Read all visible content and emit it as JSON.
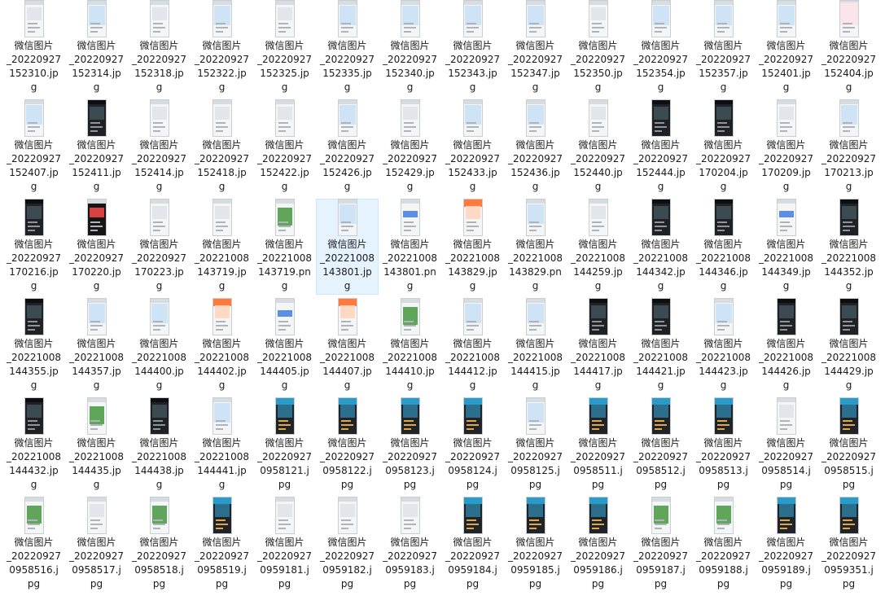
{
  "files": [
    {
      "l1": "微信图片",
      "l2": "_20220927",
      "l3": "152310.jp",
      "l4": "g",
      "thumb": "light"
    },
    {
      "l1": "微信图片",
      "l2": "_20220927",
      "l3": "152314.jp",
      "l4": "g",
      "thumb": "map"
    },
    {
      "l1": "微信图片",
      "l2": "_20220927",
      "l3": "152318.jp",
      "l4": "g",
      "thumb": "light"
    },
    {
      "l1": "微信图片",
      "l2": "_20220927",
      "l3": "152322.jp",
      "l4": "g",
      "thumb": "map"
    },
    {
      "l1": "微信图片",
      "l2": "_20220927",
      "l3": "152325.jp",
      "l4": "g",
      "thumb": "light"
    },
    {
      "l1": "微信图片",
      "l2": "_20220927",
      "l3": "152335.jp",
      "l4": "g",
      "thumb": "map"
    },
    {
      "l1": "微信图片",
      "l2": "_20220927",
      "l3": "152340.jp",
      "l4": "g",
      "thumb": "map"
    },
    {
      "l1": "微信图片",
      "l2": "_20220927",
      "l3": "152343.jp",
      "l4": "g",
      "thumb": "map"
    },
    {
      "l1": "微信图片",
      "l2": "_20220927",
      "l3": "152347.jp",
      "l4": "g",
      "thumb": "map"
    },
    {
      "l1": "微信图片",
      "l2": "_20220927",
      "l3": "152350.jp",
      "l4": "g",
      "thumb": "light"
    },
    {
      "l1": "微信图片",
      "l2": "_20220927",
      "l3": "152354.jp",
      "l4": "g",
      "thumb": "map"
    },
    {
      "l1": "微信图片",
      "l2": "_20220927",
      "l3": "152357.jp",
      "l4": "g",
      "thumb": "map"
    },
    {
      "l1": "微信图片",
      "l2": "_20220927",
      "l3": "152401.jp",
      "l4": "g",
      "thumb": "map"
    },
    {
      "l1": "微信图片",
      "l2": "_20220927",
      "l3": "152404.jp",
      "l4": "g",
      "thumb": "calli"
    },
    {
      "l1": "微信图片",
      "l2": "_20220927",
      "l3": "152407.jp",
      "l4": "g",
      "thumb": "map"
    },
    {
      "l1": "微信图片",
      "l2": "_20220927",
      "l3": "152411.jp",
      "l4": "g",
      "thumb": "dark"
    },
    {
      "l1": "微信图片",
      "l2": "_20220927",
      "l3": "152414.jp",
      "l4": "g",
      "thumb": "light"
    },
    {
      "l1": "微信图片",
      "l2": "_20220927",
      "l3": "152418.jp",
      "l4": "g",
      "thumb": "light"
    },
    {
      "l1": "微信图片",
      "l2": "_20220927",
      "l3": "152422.jp",
      "l4": "g",
      "thumb": "light"
    },
    {
      "l1": "微信图片",
      "l2": "_20220927",
      "l3": "152426.jp",
      "l4": "g",
      "thumb": "map"
    },
    {
      "l1": "微信图片",
      "l2": "_20220927",
      "l3": "152429.jp",
      "l4": "g",
      "thumb": "light"
    },
    {
      "l1": "微信图片",
      "l2": "_20220927",
      "l3": "152433.jp",
      "l4": "g",
      "thumb": "map"
    },
    {
      "l1": "微信图片",
      "l2": "_20220927",
      "l3": "152436.jp",
      "l4": "g",
      "thumb": "map"
    },
    {
      "l1": "微信图片",
      "l2": "_20220927",
      "l3": "152440.jp",
      "l4": "g",
      "thumb": "light"
    },
    {
      "l1": "微信图片",
      "l2": "_20220927",
      "l3": "152444.jp",
      "l4": "g",
      "thumb": "dark"
    },
    {
      "l1": "微信图片",
      "l2": "_20220927",
      "l3": "170204.jp",
      "l4": "g",
      "thumb": "dark"
    },
    {
      "l1": "微信图片",
      "l2": "_20220927",
      "l3": "170209.jp",
      "l4": "g",
      "thumb": "light"
    },
    {
      "l1": "微信图片",
      "l2": "_20220927",
      "l3": "170213.jp",
      "l4": "g",
      "thumb": "map"
    },
    {
      "l1": "微信图片",
      "l2": "_20220927",
      "l3": "170216.jp",
      "l4": "g",
      "thumb": "dark"
    },
    {
      "l1": "微信图片",
      "l2": "_20220927",
      "l3": "170220.jp",
      "l4": "g",
      "thumb": "red"
    },
    {
      "l1": "微信图片",
      "l2": "_20220927",
      "l3": "170223.jp",
      "l4": "g",
      "thumb": "light"
    },
    {
      "l1": "微信图片",
      "l2": "_20221008",
      "l3": "143719.jp",
      "l4": "g",
      "thumb": "light"
    },
    {
      "l1": "微信图片",
      "l2": "_20221008",
      "l3": "143719.pn",
      "l4": "g",
      "thumb": "green"
    },
    {
      "l1": "微信图片",
      "l2": "_20221008",
      "l3": "143801.jp",
      "l4": "g",
      "thumb": "map",
      "selected": true
    },
    {
      "l1": "微信图片",
      "l2": "_20221008",
      "l3": "143801.pn",
      "l4": "g",
      "thumb": "blue"
    },
    {
      "l1": "微信图片",
      "l2": "_20221008",
      "l3": "143829.jp",
      "l4": "g",
      "thumb": "orange"
    },
    {
      "l1": "微信图片",
      "l2": "_20221008",
      "l3": "143829.pn",
      "l4": "g",
      "thumb": "map"
    },
    {
      "l1": "微信图片",
      "l2": "_20221008",
      "l3": "144259.jp",
      "l4": "g",
      "thumb": "light"
    },
    {
      "l1": "微信图片",
      "l2": "_20221008",
      "l3": "144342.jp",
      "l4": "g",
      "thumb": "dark"
    },
    {
      "l1": "微信图片",
      "l2": "_20221008",
      "l3": "144346.jp",
      "l4": "g",
      "thumb": "dark"
    },
    {
      "l1": "微信图片",
      "l2": "_20221008",
      "l3": "144349.jp",
      "l4": "g",
      "thumb": "blue"
    },
    {
      "l1": "微信图片",
      "l2": "_20221008",
      "l3": "144352.jp",
      "l4": "g",
      "thumb": "dark"
    },
    {
      "l1": "微信图片",
      "l2": "_20221008",
      "l3": "144355.jp",
      "l4": "g",
      "thumb": "dark"
    },
    {
      "l1": "微信图片",
      "l2": "_20221008",
      "l3": "144357.jp",
      "l4": "g",
      "thumb": "map"
    },
    {
      "l1": "微信图片",
      "l2": "_20221008",
      "l3": "144400.jp",
      "l4": "g",
      "thumb": "map"
    },
    {
      "l1": "微信图片",
      "l2": "_20221008",
      "l3": "144402.jp",
      "l4": "g",
      "thumb": "orange"
    },
    {
      "l1": "微信图片",
      "l2": "_20221008",
      "l3": "144405.jp",
      "l4": "g",
      "thumb": "blue"
    },
    {
      "l1": "微信图片",
      "l2": "_20221008",
      "l3": "144407.jp",
      "l4": "g",
      "thumb": "orange"
    },
    {
      "l1": "微信图片",
      "l2": "_20221008",
      "l3": "144410.jp",
      "l4": "g",
      "thumb": "green"
    },
    {
      "l1": "微信图片",
      "l2": "_20221008",
      "l3": "144412.jp",
      "l4": "g",
      "thumb": "map"
    },
    {
      "l1": "微信图片",
      "l2": "_20221008",
      "l3": "144415.jp",
      "l4": "g",
      "thumb": "map"
    },
    {
      "l1": "微信图片",
      "l2": "_20221008",
      "l3": "144417.jp",
      "l4": "g",
      "thumb": "dark"
    },
    {
      "l1": "微信图片",
      "l2": "_20221008",
      "l3": "144421.jp",
      "l4": "g",
      "thumb": "dark"
    },
    {
      "l1": "微信图片",
      "l2": "_20221008",
      "l3": "144423.jp",
      "l4": "g",
      "thumb": "map"
    },
    {
      "l1": "微信图片",
      "l2": "_20221008",
      "l3": "144426.jp",
      "l4": "g",
      "thumb": "dark"
    },
    {
      "l1": "微信图片",
      "l2": "_20221008",
      "l3": "144429.jp",
      "l4": "g",
      "thumb": "dark"
    },
    {
      "l1": "微信图片",
      "l2": "_20221008",
      "l3": "144432.jp",
      "l4": "g",
      "thumb": "dark"
    },
    {
      "l1": "微信图片",
      "l2": "_20221008",
      "l3": "144435.jp",
      "l4": "g",
      "thumb": "green"
    },
    {
      "l1": "微信图片",
      "l2": "_20221008",
      "l3": "144438.jp",
      "l4": "g",
      "thumb": "dark"
    },
    {
      "l1": "微信图片",
      "l2": "_20221008",
      "l3": "144441.jp",
      "l4": "g",
      "thumb": "map"
    },
    {
      "l1": "微信图片",
      "l2": "_20220927",
      "l3": "0958121.j",
      "l4": "pg",
      "thumb": "teal"
    },
    {
      "l1": "微信图片",
      "l2": "_20220927",
      "l3": "0958122.j",
      "l4": "pg",
      "thumb": "teal"
    },
    {
      "l1": "微信图片",
      "l2": "_20220927",
      "l3": "0958123.j",
      "l4": "pg",
      "thumb": "teal"
    },
    {
      "l1": "微信图片",
      "l2": "_20220927",
      "l3": "0958124.j",
      "l4": "pg",
      "thumb": "teal"
    },
    {
      "l1": "微信图片",
      "l2": "_20220927",
      "l3": "0958125.j",
      "l4": "pg",
      "thumb": "map"
    },
    {
      "l1": "微信图片",
      "l2": "_20220927",
      "l3": "0958511.j",
      "l4": "pg",
      "thumb": "teal"
    },
    {
      "l1": "微信图片",
      "l2": "_20220927",
      "l3": "0958512.j",
      "l4": "pg",
      "thumb": "teal"
    },
    {
      "l1": "微信图片",
      "l2": "_20220927",
      "l3": "0958513.j",
      "l4": "pg",
      "thumb": "teal"
    },
    {
      "l1": "微信图片",
      "l2": "_20220927",
      "l3": "0958514.j",
      "l4": "pg",
      "thumb": "light"
    },
    {
      "l1": "微信图片",
      "l2": "_20220927",
      "l3": "0958515.j",
      "l4": "pg",
      "thumb": "teal"
    },
    {
      "l1": "微信图片",
      "l2": "_20220927",
      "l3": "0958516.j",
      "l4": "pg",
      "thumb": "green"
    },
    {
      "l1": "微信图片",
      "l2": "_20220927",
      "l3": "0958517.j",
      "l4": "pg",
      "thumb": "light"
    },
    {
      "l1": "微信图片",
      "l2": "_20220927",
      "l3": "0958518.j",
      "l4": "pg",
      "thumb": "green"
    },
    {
      "l1": "微信图片",
      "l2": "_20220927",
      "l3": "0958519.j",
      "l4": "pg",
      "thumb": "teal"
    },
    {
      "l1": "微信图片",
      "l2": "_20220927",
      "l3": "0959181.j",
      "l4": "pg",
      "thumb": "light"
    },
    {
      "l1": "微信图片",
      "l2": "_20220927",
      "l3": "0959182.j",
      "l4": "pg",
      "thumb": "light"
    },
    {
      "l1": "微信图片",
      "l2": "_20220927",
      "l3": "0959183.j",
      "l4": "pg",
      "thumb": "light"
    },
    {
      "l1": "微信图片",
      "l2": "_20220927",
      "l3": "0959184.j",
      "l4": "pg",
      "thumb": "teal"
    },
    {
      "l1": "微信图片",
      "l2": "_20220927",
      "l3": "0959185.j",
      "l4": "pg",
      "thumb": "teal"
    },
    {
      "l1": "微信图片",
      "l2": "_20220927",
      "l3": "0959186.j",
      "l4": "pg",
      "thumb": "teal"
    },
    {
      "l1": "微信图片",
      "l2": "_20220927",
      "l3": "0959187.j",
      "l4": "pg",
      "thumb": "green"
    },
    {
      "l1": "微信图片",
      "l2": "_20220927",
      "l3": "0959188.j",
      "l4": "pg",
      "thumb": "green"
    },
    {
      "l1": "微信图片",
      "l2": "_20220927",
      "l3": "0959189.j",
      "l4": "pg",
      "thumb": "teal"
    },
    {
      "l1": "微信图片",
      "l2": "_20220927",
      "l3": "0959351.j",
      "l4": "pg",
      "thumb": "teal"
    }
  ]
}
